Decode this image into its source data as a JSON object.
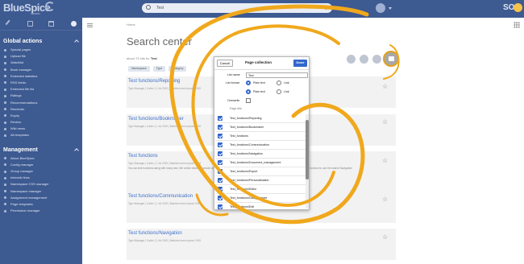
{
  "app": {
    "logo": "BlueSpice",
    "logo_sub": "MEDIAWIKI",
    "user_initials": "SO"
  },
  "search": {
    "value": "Test"
  },
  "sidebar": {
    "global_title": "Global actions",
    "global_items": [
      "Special pages",
      "Upload file",
      "Watchlist",
      "Book manager",
      "Extended statistics",
      "RSS feeds",
      "Extended file list",
      "Ratings",
      "Recommendations",
      "Reminder",
      "Expiry",
      "Review",
      "Wiki news",
      "All templates"
    ],
    "management_title": "Management",
    "management_items": [
      "About BlueSpice",
      "Config manager",
      "Group manager",
      "Interwiki links",
      "Namespace CSS manager",
      "Namespace manager",
      "Assignment management",
      "Page templates",
      "Permission manager"
    ]
  },
  "content": {
    "breadcrumb": "Home",
    "title": "Search center",
    "meta_prefix": "about 74 hits for",
    "meta_term": "Test",
    "filters": [
      "Namespace",
      "Type",
      "Category"
    ]
  },
  "results": [
    {
      "title": "Test functions/Reporting",
      "meta": "Type Manager | Carter | 1 Jul 2019 | Matches lorem ipsum 2019",
      "snippet": ""
    },
    {
      "title": "Test functions/Bookmaker",
      "meta": "Type Manager | Carter | 1 Jul 2019 | Matches lorem ipsum 2019",
      "snippet": ""
    },
    {
      "title": "Test functions",
      "meta": "Type Manager | Carter | 1 Jul 2019 | Matches lorem ipsum 2019",
      "snippet": "You can test functions along with many new. We collect results of search and different suggestions so what you can find more items. Then you can have search function to use the search Navigation"
    },
    {
      "title": "Test functions/Communication",
      "meta": "Type Manager | Carter | 1 Jul 2019 | Matches lorem ipsum 2019",
      "snippet": ""
    },
    {
      "title": "Test functions/Navigation",
      "meta": "Type Manager | Carter | 1 Jul 2019 | Matches lorem ipsum 2019",
      "snippet": ""
    }
  ],
  "dialog": {
    "cancel": "Cancel",
    "title": "Page collection",
    "done": "Done",
    "list_name_label": "List name",
    "list_name_value": "Test",
    "list_format_label": "List format",
    "opt_plain": "Plain text",
    "opt_link": "Link",
    "overwrite_label": "Overwrite",
    "col_header": "Page title",
    "rows": [
      "Test_functions/Reporting",
      "Test_functions/Bookmaker",
      "Test_functions",
      "Test_functions/Communication",
      "Test_functions/Navigation",
      "Test_functions/Document_management",
      "Test_functions/Export",
      "Test_functions/Personalisation",
      "Test_functions/Editor",
      "Test_functions/Data_Analyze",
      "Test_functions/Edit"
    ]
  },
  "colors": {
    "sidebar": "#3d5a91",
    "accent": "#3366cc",
    "swirl": "#f0a81c"
  }
}
